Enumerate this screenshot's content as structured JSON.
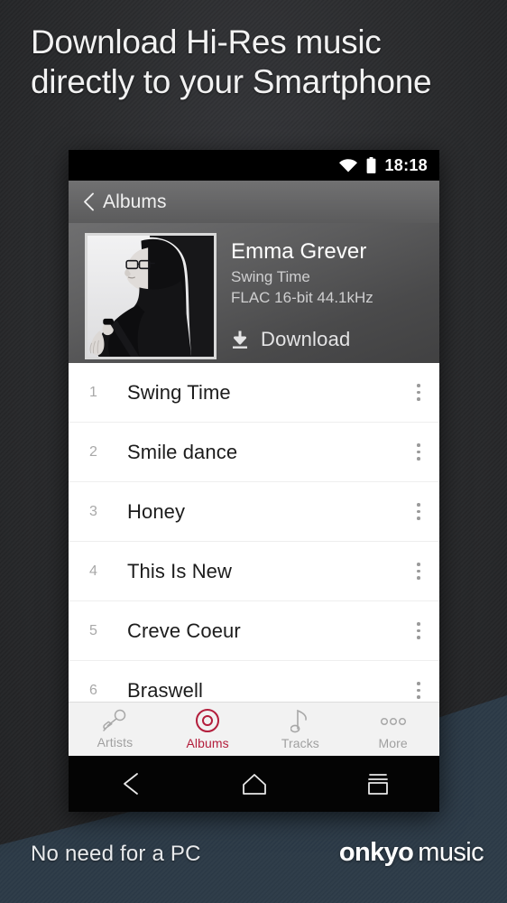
{
  "promo": {
    "headline_line1": "Download Hi-Res music",
    "headline_line2": "directly to your Smartphone",
    "footer_tagline": "No need for a PC",
    "brand_primary": "onkyo",
    "brand_secondary": "music",
    "accent_color": "#b31e3c",
    "background_color": "#27282a",
    "background_accent_color": "#2b3946"
  },
  "phone": {
    "statusbar": {
      "wifi_icon": "wifi-icon",
      "battery_icon": "battery-icon",
      "clock": "18:18"
    },
    "actionbar": {
      "back_icon": "chevron-left-icon",
      "title": "Albums"
    },
    "album": {
      "cover_alt": "album-artwork-black-and-white-portrait",
      "artist": "Emma Grever",
      "title": "Swing Time",
      "format": "FLAC 16-bit 44.1kHz",
      "download_icon": "download-icon",
      "download_label": "Download"
    },
    "tracks": [
      {
        "number": "1",
        "title": "Swing Time",
        "menu_icon": "overflow-menu-icon"
      },
      {
        "number": "2",
        "title": "Smile dance",
        "menu_icon": "overflow-menu-icon"
      },
      {
        "number": "3",
        "title": "Honey",
        "menu_icon": "overflow-menu-icon"
      },
      {
        "number": "4",
        "title": "This Is New",
        "menu_icon": "overflow-menu-icon"
      },
      {
        "number": "5",
        "title": "Creve Coeur",
        "menu_icon": "overflow-menu-icon"
      },
      {
        "number": "6",
        "title": "Braswell",
        "menu_icon": "overflow-menu-icon"
      }
    ],
    "tabbar": {
      "active": "Albums",
      "items": [
        {
          "label": "Artists",
          "icon": "microphone-icon"
        },
        {
          "label": "Albums",
          "icon": "vinyl-record-icon"
        },
        {
          "label": "Tracks",
          "icon": "music-note-icon"
        },
        {
          "label": "More",
          "icon": "more-dots-icon"
        }
      ]
    },
    "navbar": {
      "back_icon": "android-back-icon",
      "home_icon": "android-home-icon",
      "recents_icon": "android-recents-icon"
    }
  }
}
